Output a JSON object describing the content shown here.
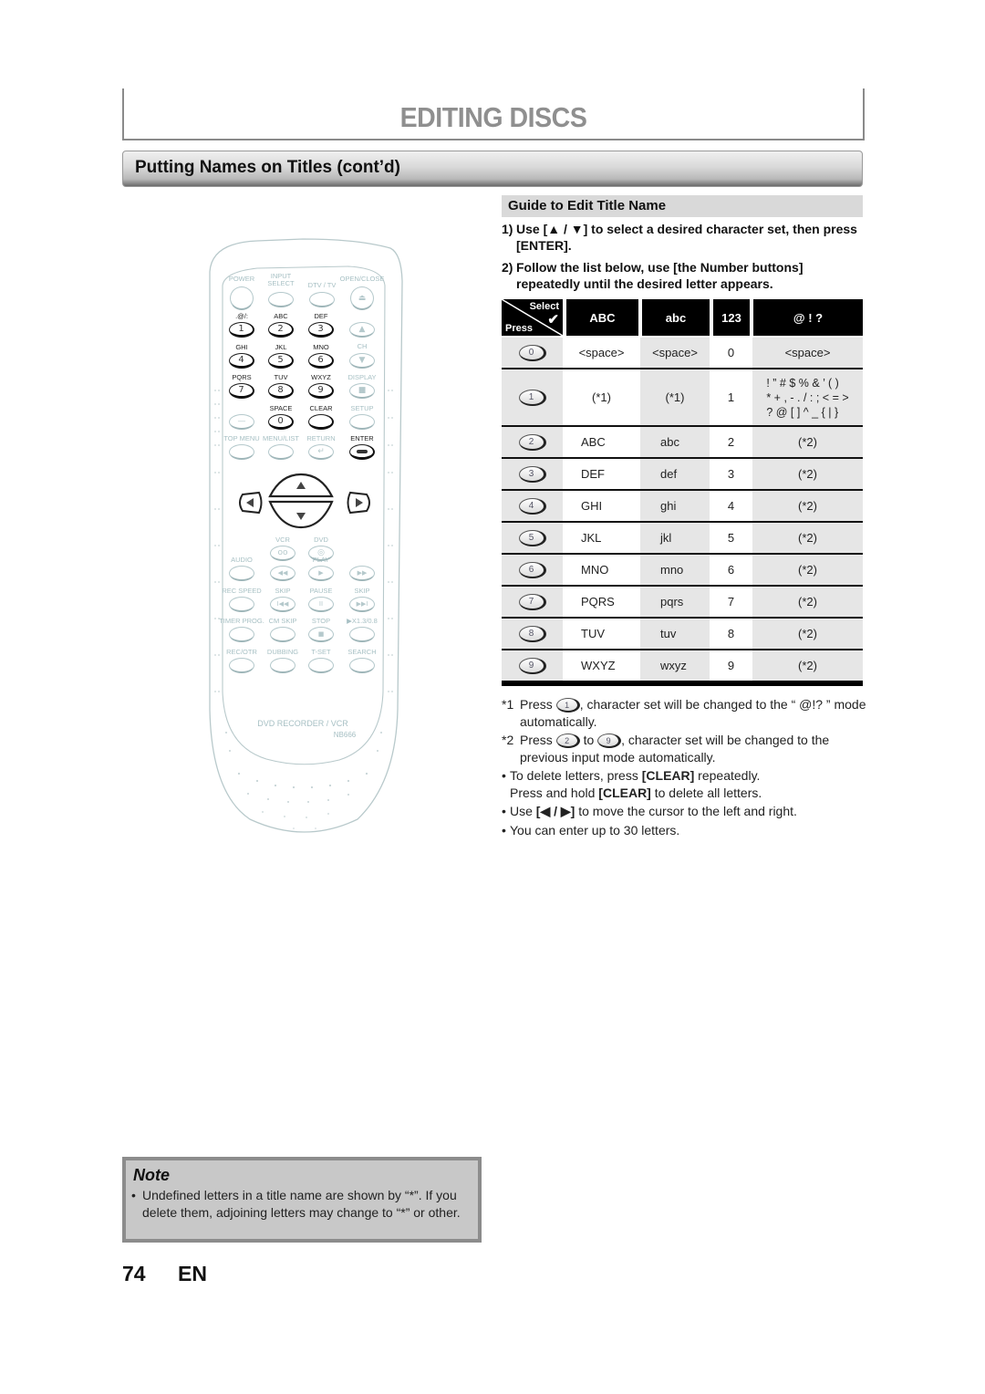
{
  "header": {
    "chapter_title": "EDITING DISCS",
    "section_title": "Putting Names on Titles (cont’d)"
  },
  "guide": {
    "title": "Guide to Edit Title Name",
    "steps": [
      {
        "num": "1)",
        "text": "Use [▲ / ▼] to select a desired character set, then press [ENTER]."
      },
      {
        "num": "2)",
        "text": "Follow the list below, use [the Number buttons] repeatedly until the desired letter appears."
      }
    ]
  },
  "table": {
    "corner_select": "Select",
    "corner_press": "Press",
    "corner_icon": "checkmark-icon",
    "headers": [
      "ABC",
      "abc",
      "123",
      "@ ! ?"
    ],
    "rows": [
      {
        "key": "0",
        "upper": "<space>",
        "lower": "<space>",
        "number": "0",
        "symbol": "<space>"
      },
      {
        "key": "1",
        "upper": "(*1)",
        "lower": "(*1)",
        "number": "1",
        "symbol_lines": [
          "! ” # $ % & ’ ( )",
          "* + , - . / : ; < = >",
          "? @ [ ] ^ _ { | }"
        ]
      },
      {
        "key": "2",
        "upper": "ABC",
        "lower": "abc",
        "number": "2",
        "symbol": "(*2)"
      },
      {
        "key": "3",
        "upper": "DEF",
        "lower": "def",
        "number": "3",
        "symbol": "(*2)"
      },
      {
        "key": "4",
        "upper": "GHI",
        "lower": "ghi",
        "number": "4",
        "symbol": "(*2)"
      },
      {
        "key": "5",
        "upper": "JKL",
        "lower": "jkl",
        "number": "5",
        "symbol": "(*2)"
      },
      {
        "key": "6",
        "upper": "MNO",
        "lower": "mno",
        "number": "6",
        "symbol": "(*2)"
      },
      {
        "key": "7",
        "upper": "PQRS",
        "lower": "pqrs",
        "number": "7",
        "symbol": "(*2)"
      },
      {
        "key": "8",
        "upper": "TUV",
        "lower": "tuv",
        "number": "8",
        "symbol": "(*2)"
      },
      {
        "key": "9",
        "upper": "WXYZ",
        "lower": "wxyz",
        "number": "9",
        "symbol": "(*2)"
      }
    ]
  },
  "footnotes": {
    "fn1": {
      "mark": "*1",
      "pre": "Press",
      "key": "1",
      "post": ", character set will be changed to the “ @!? ” mode automatically."
    },
    "fn2": {
      "mark": "*2",
      "pre": "Press",
      "key_from": "2",
      "mid": "to",
      "key_to": "9",
      "post": ", character set will be changed to the previous input mode automatically."
    },
    "bullets": [
      {
        "mark": "•",
        "parts": [
          "To delete letters, press ",
          "[CLEAR]",
          " repeatedly."
        ],
        "line2": [
          "Press and hold ",
          "[CLEAR]",
          " to delete all letters."
        ]
      },
      {
        "mark": "•",
        "parts": [
          "Use ",
          "[◀ / ▶]",
          " to move the cursor to the left and right."
        ]
      },
      {
        "mark": "•",
        "parts": [
          "You can enter up to 30 letters."
        ]
      }
    ]
  },
  "remote": {
    "model_label": "DVD RECORDER / VCR",
    "model_code": "NB666",
    "top_labels": {
      "power": "POWER",
      "input_select": "INPUT\nSELECT",
      "dtv_tv": "DTV / TV",
      "open_close": "OPEN/CLOSE"
    },
    "number_keys": [
      {
        "label": ".@/:",
        "key": "1"
      },
      {
        "label": "ABC",
        "key": "2"
      },
      {
        "label": "DEF",
        "key": "3"
      },
      {
        "label": "GHI",
        "key": "4"
      },
      {
        "label": "JKL",
        "key": "5"
      },
      {
        "label": "MNO",
        "key": "6"
      },
      {
        "label": "PQRS",
        "key": "7"
      },
      {
        "label": "TUV",
        "key": "8"
      },
      {
        "label": "WXYZ",
        "key": "9"
      },
      {
        "label": "SPACE",
        "key": "0"
      }
    ],
    "side_labels": {
      "ch": "CH",
      "display": "DISPLAY",
      "setup": "SETUP",
      "clear": "CLEAR"
    },
    "menu_labels": {
      "top_menu": "TOP MENU",
      "menu_list": "MENU/LIST",
      "return": "RETURN",
      "enter": "ENTER"
    },
    "source_labels": {
      "vcr": "VCR",
      "dvd": "DVD"
    },
    "transport_rows": [
      [
        "AUDIO",
        "",
        "PLAY",
        ""
      ],
      [
        "REC SPEED",
        "SKIP",
        "PAUSE",
        "SKIP"
      ],
      [
        "TIMER PROG.",
        "CM SKIP",
        "STOP",
        "▶X1.3/0.8"
      ],
      [
        "REC/OTR",
        "DUBBING",
        "T-SET",
        "SEARCH"
      ]
    ],
    "transport_icons": [
      [
        "",
        "◀◀",
        "▶",
        "▶▶"
      ],
      [
        "",
        "I◀◀",
        "II",
        "▶▶I"
      ],
      [
        "",
        "",
        "■",
        ""
      ],
      [
        "",
        "",
        "",
        ""
      ]
    ]
  },
  "note": {
    "title": "Note",
    "mark": "•",
    "text": "Undefined letters in a title name are shown by “*”. If you delete them, adjoining letters may change to “*” or other."
  },
  "footer": {
    "page_number": "74",
    "language": "EN"
  }
}
